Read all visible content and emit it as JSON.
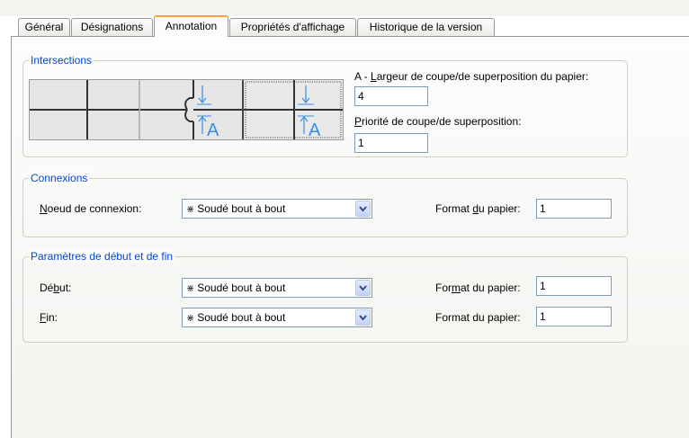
{
  "tabs": [
    {
      "label": "Général"
    },
    {
      "label": "Désignations"
    },
    {
      "label": "Annotation",
      "active": true
    },
    {
      "label": "Propriétés d'affichage"
    },
    {
      "label": "Historique de la version"
    }
  ],
  "intersections": {
    "title": "Intersections",
    "width_label_prefix": "A - ",
    "width_label_key": "L",
    "width_label_rest": "argeur de coupe/de superposition du papier:",
    "width_value": "4",
    "priority_label_key": "P",
    "priority_label_rest": "riorité de coupe/de superposition:",
    "priority_value": "1",
    "options": [
      {
        "name": "plain-cross"
      },
      {
        "name": "cross-left-hook"
      },
      {
        "name": "cross-right-selected",
        "selected": true
      }
    ],
    "annotation_letter": "A"
  },
  "connexions": {
    "title": "Connexions",
    "node_label_key": "N",
    "node_label_rest": "oeud de connexion:",
    "node_value": "Soudé bout à bout",
    "node_symbol": "⋇",
    "paper_label_pre": "Format ",
    "paper_label_key": "d",
    "paper_label_rest": "u papier:",
    "paper_value": "1"
  },
  "start_end": {
    "title": "Paramètres de début et de fin",
    "start_label_pre": "Dé",
    "start_label_key": "b",
    "start_label_rest": "ut:",
    "start_value": "Soudé bout à bout",
    "start_symbol": "⋇",
    "start_paper_pre": "For",
    "start_paper_key": "m",
    "start_paper_rest": "at du papier:",
    "start_paper_value": "1",
    "end_label_key": "F",
    "end_label_rest": "in:",
    "end_value": "Soudé bout à bout",
    "end_symbol": "⋇",
    "end_paper_label": "Format du papier:",
    "end_paper_value": "1"
  },
  "colors": {
    "accent_tab": "#f5a623",
    "group_title": "#0046d5",
    "annotation_blue": "#3a8ee6"
  }
}
